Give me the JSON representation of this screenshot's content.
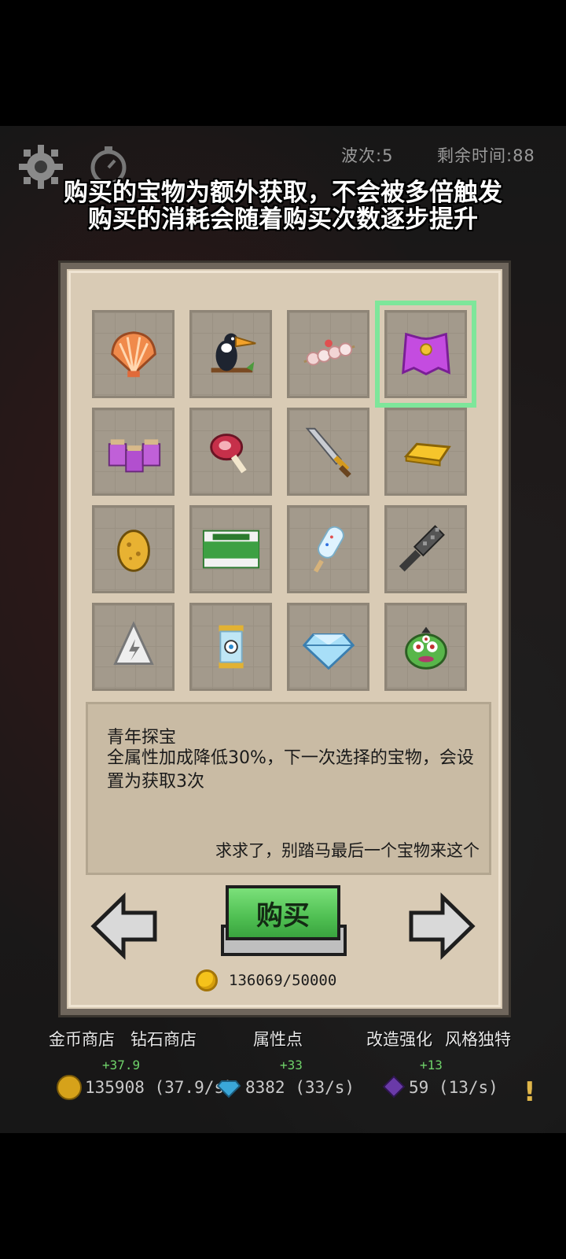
{
  "hud": {
    "wave_label": "波次:5",
    "time_label": "剩余时间:88"
  },
  "notice": {
    "line1": "购买的宝物为额外获取，不会被多倍触发",
    "line2": "购买的消耗会随着购买次数逐步提升"
  },
  "items": [
    {
      "name": "shell-icon"
    },
    {
      "name": "toucan-icon"
    },
    {
      "name": "skewer-icon"
    },
    {
      "name": "purple-cape-icon",
      "selected": true
    },
    {
      "name": "potion-jars-icon"
    },
    {
      "name": "ham-icon"
    },
    {
      "name": "sword-icon"
    },
    {
      "name": "gold-bar-icon"
    },
    {
      "name": "golden-egg-icon"
    },
    {
      "name": "medicine-box-icon"
    },
    {
      "name": "popsicle-icon"
    },
    {
      "name": "spiked-club-icon"
    },
    {
      "name": "lightning-cone-icon"
    },
    {
      "name": "eye-capsule-icon"
    },
    {
      "name": "diamond-icon"
    },
    {
      "name": "green-monster-icon"
    }
  ],
  "description": {
    "title": "青年探宝",
    "body": "全属性加成降低30%，下一次选择的宝物，会设置为获取3次",
    "quote": "求求了，别踏马最后一个宝物来这个"
  },
  "buy": {
    "label": "购买",
    "cost": "136069/50000"
  },
  "nav": {
    "gold_shop": "金币商店",
    "diamond_shop": "钻石商店",
    "attributes": "属性点",
    "upgrade": "改造强化",
    "style": "风格独特"
  },
  "resources": {
    "gold": "135908 (37.9/s)",
    "gold_delta": "+37.9",
    "diamond": "8382 (33/s)",
    "diamond_delta": "+33",
    "gem": "59 (13/s)",
    "gem_delta": "+13"
  },
  "colors": {
    "selected_outline": "#7ee69a",
    "buy_button": "#4fbf52",
    "panel": "#d9cbb5"
  }
}
